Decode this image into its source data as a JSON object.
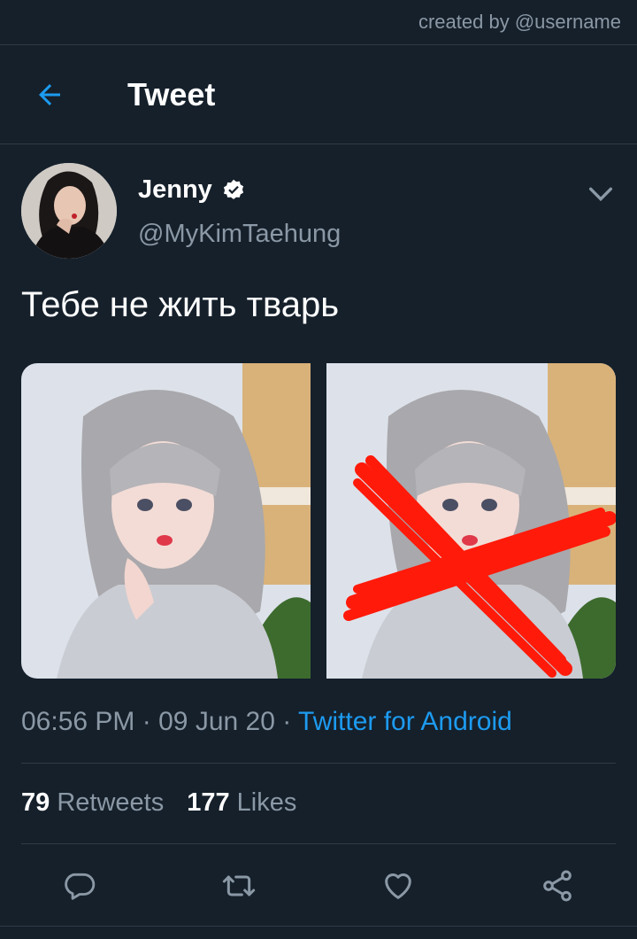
{
  "watermark": "created by @username",
  "header": {
    "title": "Tweet"
  },
  "author": {
    "name": "Jenny",
    "handle": "@MyKimTaehung",
    "verified": true
  },
  "tweet": {
    "text": "Тебе не жить тварь",
    "time": "06:56 PM",
    "date": "09 Jun 20",
    "separator": "·",
    "source": "Twitter for Android"
  },
  "stats": {
    "retweets_count": "79",
    "retweets_label": "Retweets",
    "likes_count": "177",
    "likes_label": "Likes"
  },
  "icons": {
    "back": "back-arrow-icon",
    "verified": "verified-badge-icon",
    "more": "chevron-down-icon",
    "reply": "reply-icon",
    "retweet": "retweet-icon",
    "like": "heart-icon",
    "share": "share-icon"
  },
  "colors": {
    "background": "#15202b",
    "accent": "#1d9bf0",
    "muted": "#8b98a5",
    "cross": "#ff1a0a"
  }
}
